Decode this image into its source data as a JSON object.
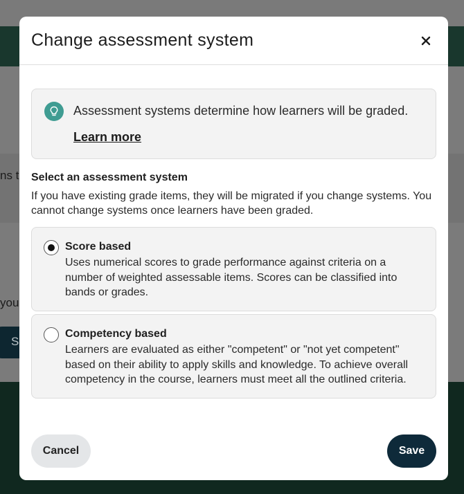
{
  "background": {
    "partial_text_1": "ns t",
    "partial_text_2": "you",
    "partial_button": "Sa"
  },
  "modal": {
    "title": "Change assessment system",
    "close_icon": "close-icon",
    "info": {
      "icon": "lightbulb-icon",
      "text": "Assessment systems determine how learners will be graded.",
      "link": "Learn more"
    },
    "section_label": "Select an assessment system",
    "section_desc": "If you have existing grade items, they will be migrated if you change systems. You cannot change systems once learners have been graded.",
    "options": [
      {
        "title": "Score based",
        "description": "Uses numerical scores to grade performance against criteria on a number of weighted assessable items. Scores can be classified into bands or grades.",
        "selected": true
      },
      {
        "title": "Competency based",
        "description": "Learners are evaluated as either \"competent\" or \"not yet competent\" based on their ability to apply skills and knowledge. To achieve overall competency in the course, learners must meet all the outlined criteria.",
        "selected": false
      }
    ],
    "cancel_label": "Cancel",
    "save_label": "Save"
  },
  "colors": {
    "accent_teal": "#3f9c92",
    "save_button": "#0e2a3a",
    "backdrop_green": "#19372d"
  }
}
